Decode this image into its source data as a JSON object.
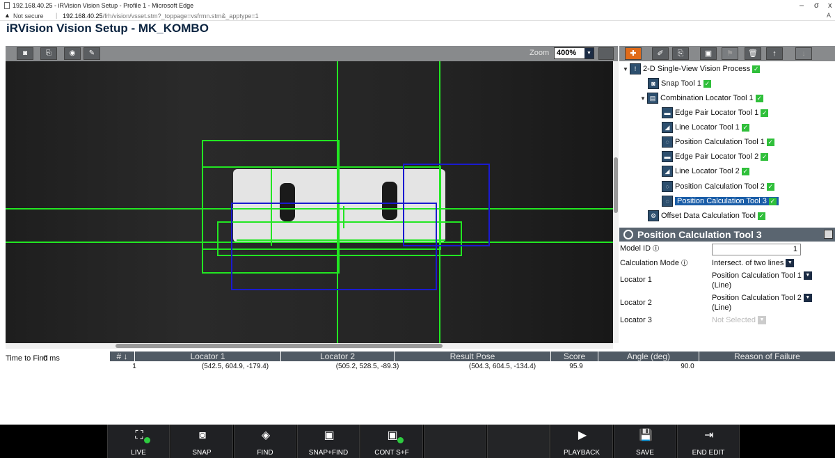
{
  "browser": {
    "window_title": "192.168.40.25 - iRVision Vision Setup - Profile 1 - Microsoft Edge",
    "security": "Not secure",
    "url_host": "192.168.40.25",
    "url_path": "/frh/vision/vsset.stm?_toppage=vsfrmn.stm&_apptype=1",
    "minimize": "–",
    "restore": "σ",
    "close": "x"
  },
  "app": {
    "title": "iRVision Vision Setup - MK_KOMBO"
  },
  "image_toolbar": {
    "zoom_label": "Zoom",
    "zoom_value": "400%",
    "buttons": [
      "camera-icon",
      "save-image-icon",
      "snap-icon",
      "pen-icon"
    ]
  },
  "tree": {
    "nodes": [
      {
        "label": "2-D Single-View Vision Process",
        "icon": "process-icon",
        "checked": true,
        "expanded": true
      },
      {
        "label": "Snap Tool 1",
        "icon": "snap-tool-icon",
        "checked": true
      },
      {
        "label": "Combination Locator Tool 1",
        "icon": "combination-locator-icon",
        "checked": true,
        "expanded": true
      },
      {
        "label": "Edge Pair Locator Tool 1",
        "icon": "edge-pair-icon",
        "checked": true
      },
      {
        "label": "Line Locator Tool 1",
        "icon": "line-locator-icon",
        "checked": true
      },
      {
        "label": "Position Calculation Tool 1",
        "icon": "position-calc-icon",
        "checked": true
      },
      {
        "label": "Edge Pair Locator Tool 2",
        "icon": "edge-pair-icon",
        "checked": true
      },
      {
        "label": "Line Locator Tool 2",
        "icon": "line-locator-icon",
        "checked": true
      },
      {
        "label": "Position Calculation Tool 2",
        "icon": "position-calc-icon",
        "checked": true
      },
      {
        "label": "Position Calculation Tool 3",
        "icon": "position-calc-icon",
        "checked": true,
        "selected": true
      },
      {
        "label": "Offset Data Calculation Tool",
        "icon": "offset-data-icon",
        "checked": true
      }
    ]
  },
  "properties": {
    "title": "Position Calculation Tool 3",
    "model_id_label": "Model ID",
    "model_id_value": "1",
    "calc_mode_label": "Calculation Mode",
    "calc_mode_value": "Intersect. of two lines",
    "locator1_label": "Locator  1",
    "locator1_value": "Position Calculation Tool 1",
    "locator1_sub": "(Line)",
    "locator2_label": "Locator  2",
    "locator2_value": "Position Calculation Tool 2",
    "locator2_sub": "(Line)",
    "locator3_label": "Locator  3",
    "locator3_value": "Not Selected"
  },
  "results": {
    "time_to_find_label": "Time to Find",
    "time_to_find_value": "0 ms",
    "columns": [
      "#",
      "Locator 1",
      "Locator 2",
      "Result Pose",
      "Score",
      "Angle (deg)",
      "Reason of Failure"
    ],
    "rows": [
      {
        "num": "1",
        "locator1": "(542.5, 604.9, -179.4)",
        "locator2": "(505.2, 528.5, -89.3)",
        "result_pose": "(504.3, 604.5, -134.4)",
        "score": "95.9",
        "angle": "90.0",
        "reason": ""
      }
    ]
  },
  "bottom_bar": {
    "buttons": [
      {
        "label": "LIVE",
        "icon": "live-icon"
      },
      {
        "label": "SNAP",
        "icon": "snap-icon"
      },
      {
        "label": "FIND",
        "icon": "find-icon"
      },
      {
        "label": "SNAP+FIND",
        "icon": "snap-find-icon"
      },
      {
        "label": "CONT S+F",
        "icon": "cont-snap-find-icon"
      },
      {
        "label": "",
        "icon": ""
      },
      {
        "label": "",
        "icon": ""
      },
      {
        "label": "PLAYBACK",
        "icon": "playback-icon"
      },
      {
        "label": "SAVE",
        "icon": "save-icon"
      },
      {
        "label": "END EDIT",
        "icon": "end-edit-icon"
      }
    ]
  },
  "colors": {
    "locator_green": "#22e622",
    "locator_blue": "#1a1ad0",
    "selected_blue": "#1b5ea8",
    "check_green": "#2fbf3a",
    "header_gray": "#505a64"
  }
}
